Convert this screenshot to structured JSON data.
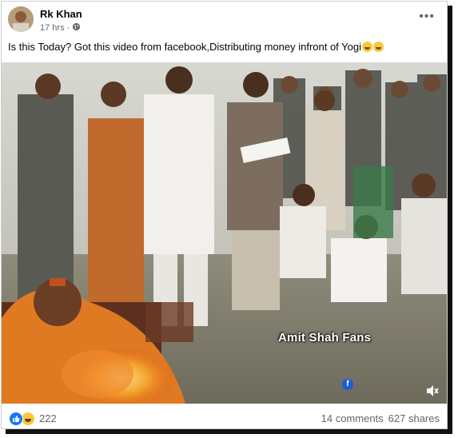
{
  "post": {
    "author": "Rk Khan",
    "timestamp": "17 hrs",
    "separator": "·",
    "privacy_icon": "globe-icon",
    "more_icon": "more-options-icon",
    "caption": "Is this Today? Got this video from facebook,Distributing money infront of Yogi",
    "caption_emojis": [
      "grimacing-face-emoji",
      "grimacing-face-emoji"
    ]
  },
  "video": {
    "watermark": "Amit Shah Fans",
    "watermark_icon": "facebook-icon",
    "watermark_badge": "f",
    "mute_icon": "mute-icon"
  },
  "footer": {
    "reaction_icons": [
      "like-icon",
      "haha-icon"
    ],
    "reaction_count": "222",
    "comments": "14 comments",
    "shares": "627 shares"
  },
  "colors": {
    "accent": "#1877f2",
    "secondary_text": "#65676b",
    "primary_text": "#050505"
  }
}
